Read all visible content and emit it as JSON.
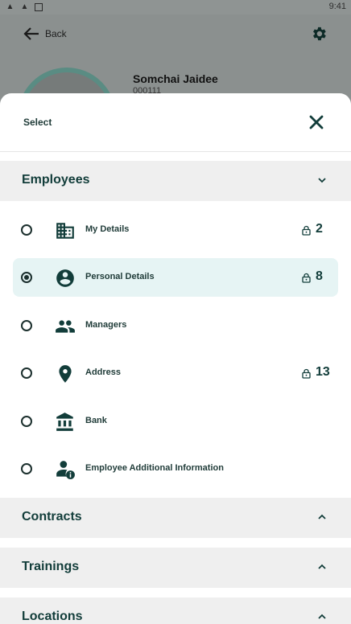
{
  "status_bar": {
    "time": "9:41"
  },
  "background": {
    "back_label": "Back",
    "name": "Somchai Jaidee",
    "employee_id": "000111"
  },
  "sheet": {
    "title": "Select",
    "sections": [
      {
        "label": "Employees",
        "expanded": true,
        "items": [
          {
            "label": "My Details",
            "icon": "building-icon",
            "locked": true,
            "count": "2",
            "selected": false
          },
          {
            "label": "Personal Details",
            "icon": "account-circle-icon",
            "locked": true,
            "count": "8",
            "selected": true
          },
          {
            "label": "Managers",
            "icon": "people-icon",
            "locked": false,
            "count": "",
            "selected": false
          },
          {
            "label": "Address",
            "icon": "location-pin-icon",
            "locked": true,
            "count": "13",
            "selected": false
          },
          {
            "label": "Bank",
            "icon": "bank-icon",
            "locked": false,
            "count": "",
            "selected": false
          },
          {
            "label": "Employee Additional Information",
            "icon": "person-info-icon",
            "locked": false,
            "count": "",
            "selected": false
          }
        ]
      },
      {
        "label": "Contracts",
        "expanded": false
      },
      {
        "label": "Trainings",
        "expanded": false
      },
      {
        "label": "Locations",
        "expanded": false
      }
    ]
  },
  "colors": {
    "accent": "#123d3a",
    "selected_row": "#e6f4f4",
    "section_bg": "#efefef"
  }
}
